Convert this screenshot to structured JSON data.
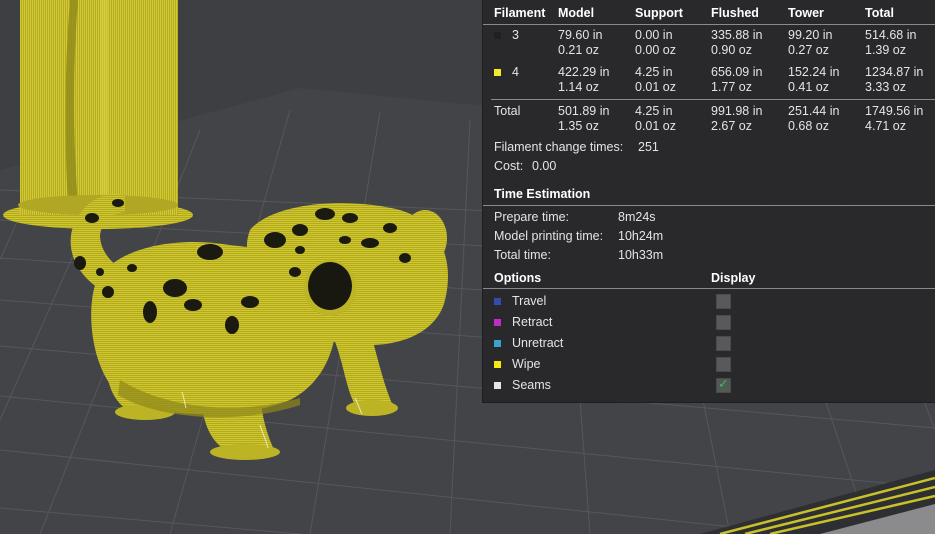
{
  "stats": {
    "columns": [
      "Filament",
      "Model",
      "Support",
      "Flushed",
      "Tower",
      "Total"
    ],
    "rows": [
      {
        "filament": "3",
        "color": "#202020",
        "model": [
          "79.60 in",
          "0.21 oz"
        ],
        "support": [
          "0.00 in",
          "0.00 oz"
        ],
        "flushed": [
          "335.88 in",
          "0.90 oz"
        ],
        "tower": [
          "99.20 in",
          "0.27 oz"
        ],
        "total": [
          "514.68 in",
          "1.39 oz"
        ]
      },
      {
        "filament": "4",
        "color": "#f2ea2a",
        "model": [
          "422.29 in",
          "1.14 oz"
        ],
        "support": [
          "4.25 in",
          "0.01 oz"
        ],
        "flushed": [
          "656.09 in",
          "1.77 oz"
        ],
        "tower": [
          "152.24 in",
          "0.41 oz"
        ],
        "total": [
          "1234.87 in",
          "3.33 oz"
        ]
      }
    ],
    "total_row": {
      "label": "Total",
      "model": [
        "501.89 in",
        "1.35 oz"
      ],
      "support": [
        "4.25 in",
        "0.01 oz"
      ],
      "flushed": [
        "991.98 in",
        "2.67 oz"
      ],
      "tower": [
        "251.44 in",
        "0.68 oz"
      ],
      "total": [
        "1749.56 in",
        "4.71 oz"
      ]
    },
    "filament_change_label": "Filament change times:",
    "filament_change_value": "251",
    "cost_label": "Cost:",
    "cost_value": "0.00"
  },
  "time_estimation": {
    "title": "Time Estimation",
    "rows": [
      {
        "label": "Prepare time:",
        "value": "8m24s"
      },
      {
        "label": "Model printing time:",
        "value": "10h24m"
      },
      {
        "label": "Total time:",
        "value": "10h33m"
      }
    ]
  },
  "options": {
    "title": "Options",
    "display_title": "Display",
    "items": [
      {
        "label": "Travel",
        "color": "#3a4aa8",
        "checked": false
      },
      {
        "label": "Retract",
        "color": "#c02cc8",
        "checked": false
      },
      {
        "label": "Unretract",
        "color": "#3aa2cc",
        "checked": false
      },
      {
        "label": "Wipe",
        "color": "#f2ea10",
        "checked": false
      },
      {
        "label": "Seams",
        "color": "#e6e6e6",
        "checked": true
      }
    ]
  },
  "colors": {
    "model_yellow": "#c9c12a",
    "spot_black": "#1a1a10",
    "plate_grey": "#3d3e42",
    "panel_bg": "#28282b"
  }
}
